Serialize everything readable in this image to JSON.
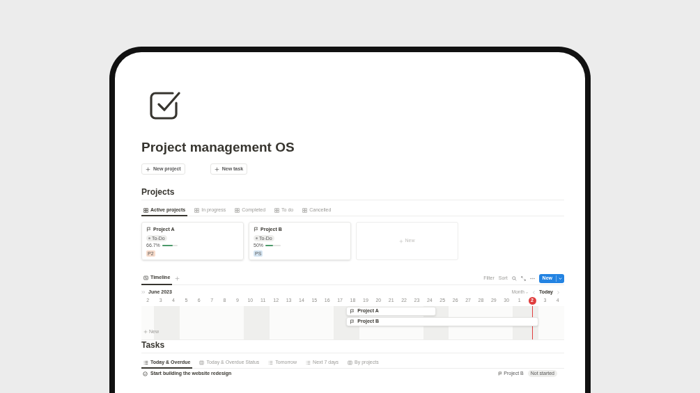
{
  "page": {
    "title": "Project management OS",
    "buttons": [
      "New project",
      "New task"
    ]
  },
  "projects": {
    "heading": "Projects",
    "tabs": [
      {
        "label": "Active projects",
        "kind": "gallery",
        "selected": true
      },
      {
        "label": "In progress",
        "kind": "gallery",
        "selected": false
      },
      {
        "label": "Completed",
        "kind": "gallery",
        "selected": false
      },
      {
        "label": "To do",
        "kind": "gallery",
        "selected": false
      },
      {
        "label": "Cancelled",
        "kind": "gallery",
        "selected": false
      }
    ],
    "cards": [
      {
        "title": "Project A",
        "status": "To-Do",
        "progress": "66.7%",
        "level": 0.667,
        "tag": {
          "label": "P2",
          "color": "#f8dccb"
        }
      },
      {
        "title": "Project B",
        "status": "To-Do",
        "progress": "50%",
        "level": 0.5,
        "tag": {
          "label": "PS",
          "color": "#d6e6f3"
        }
      }
    ],
    "new_card": "New"
  },
  "timeline": {
    "tab": {
      "label": "Timeline",
      "selected": true
    },
    "toolbar": [
      "Filter",
      "Sort"
    ],
    "new_button": "New",
    "month": "June 2023",
    "scale": "Month",
    "today_button": "Today",
    "days": [
      {
        "label": "2",
        "weekend": false,
        "today": false
      },
      {
        "label": "3",
        "weekend": true,
        "today": false
      },
      {
        "label": "4",
        "weekend": true,
        "today": false
      },
      {
        "label": "5",
        "weekend": false,
        "today": false
      },
      {
        "label": "6",
        "weekend": false,
        "today": false
      },
      {
        "label": "7",
        "weekend": false,
        "today": false
      },
      {
        "label": "8",
        "weekend": false,
        "today": false
      },
      {
        "label": "9",
        "weekend": false,
        "today": false
      },
      {
        "label": "10",
        "weekend": true,
        "today": false
      },
      {
        "label": "11",
        "weekend": true,
        "today": false
      },
      {
        "label": "12",
        "weekend": false,
        "today": false
      },
      {
        "label": "13",
        "weekend": false,
        "today": false
      },
      {
        "label": "14",
        "weekend": false,
        "today": false
      },
      {
        "label": "15",
        "weekend": false,
        "today": false
      },
      {
        "label": "16",
        "weekend": false,
        "today": false
      },
      {
        "label": "17",
        "weekend": true,
        "today": false
      },
      {
        "label": "18",
        "weekend": true,
        "today": false
      },
      {
        "label": "19",
        "weekend": false,
        "today": false
      },
      {
        "label": "20",
        "weekend": false,
        "today": false
      },
      {
        "label": "21",
        "weekend": false,
        "today": false
      },
      {
        "label": "22",
        "weekend": false,
        "today": false
      },
      {
        "label": "23",
        "weekend": false,
        "today": false
      },
      {
        "label": "24",
        "weekend": true,
        "today": false
      },
      {
        "label": "25",
        "weekend": true,
        "today": false
      },
      {
        "label": "26",
        "weekend": false,
        "today": false
      },
      {
        "label": "27",
        "weekend": false,
        "today": false
      },
      {
        "label": "28",
        "weekend": false,
        "today": false
      },
      {
        "label": "29",
        "weekend": false,
        "today": false
      },
      {
        "label": "30",
        "weekend": false,
        "today": false
      },
      {
        "label": "1",
        "weekend": true,
        "today": false
      },
      {
        "label": "2",
        "weekend": true,
        "today": true
      },
      {
        "label": "3",
        "weekend": false,
        "today": false
      },
      {
        "label": "4",
        "weekend": false,
        "today": false
      }
    ],
    "items": [
      "Project A",
      "Project B"
    ],
    "add_row": "New"
  },
  "tasks": {
    "heading": "Tasks",
    "tabs": [
      {
        "label": "Today & Overdue",
        "kind": "list",
        "selected": true
      },
      {
        "label": "Today & Overdue Status",
        "kind": "board",
        "selected": false
      },
      {
        "label": "Tomorrow",
        "kind": "list",
        "selected": false
      },
      {
        "label": "Next 7 days",
        "kind": "list",
        "selected": false
      },
      {
        "label": "By projects",
        "kind": "board",
        "selected": false
      }
    ],
    "rows": [
      {
        "title": "Start building the website redesign",
        "project": "Project B",
        "status": "Not started"
      }
    ]
  }
}
